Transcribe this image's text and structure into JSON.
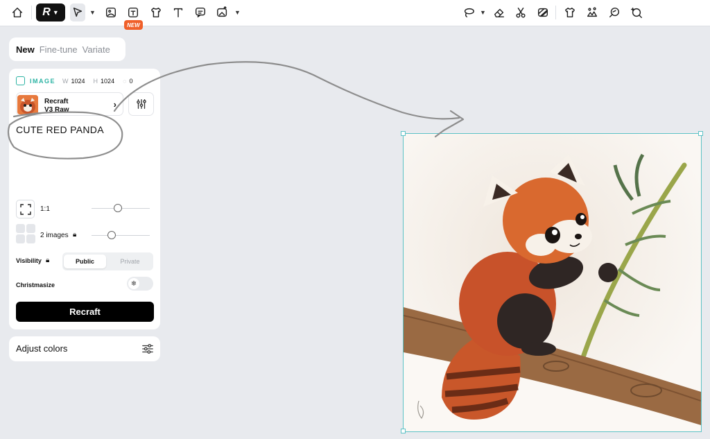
{
  "toolbar": {
    "new_badge": "NEW",
    "logo_letter": "R"
  },
  "panel": {
    "tabs": [
      {
        "label": "New",
        "active": true
      },
      {
        "label": "Fine-tune",
        "active": false
      },
      {
        "label": "Variate",
        "active": false
      }
    ],
    "image_type": "IMAGE",
    "width_key": "W",
    "width": "1024",
    "height_key": "H",
    "height": "1024",
    "seed": "0",
    "model": {
      "line1": "Recraft",
      "line2": "V3 Raw"
    },
    "prompt": "CUTE RED PANDA",
    "aspect_ratio": "1:1",
    "image_count": "2 images",
    "visibility_label": "Visibility",
    "visibility_options": [
      "Public",
      "Private"
    ],
    "visibility_selected": "Public",
    "christmasize_label": "Christmasize",
    "generate_label": "Recraft",
    "adjust_colors_label": "Adjust colors"
  },
  "colors": {
    "accent": "#2bb3a3",
    "badge": "#f0602a",
    "selection": "#5cc2c6",
    "primary_button": "#000000",
    "canvas_bg": "#e8eaee"
  },
  "icons": {
    "toolbar_left": [
      "home-icon",
      "recraft-logo-icon",
      "select-arrow-icon",
      "image-frame-icon",
      "text-frame-icon",
      "mockup-icon",
      "text-icon",
      "comment-icon",
      "image-upload-icon"
    ],
    "toolbar_right": [
      "lasso-icon",
      "eraser-icon",
      "scissors-icon",
      "remove-bg-icon",
      "tshirt-icon",
      "creative-upscale-icon",
      "vectorize-icon",
      "magic-brush-icon"
    ]
  }
}
